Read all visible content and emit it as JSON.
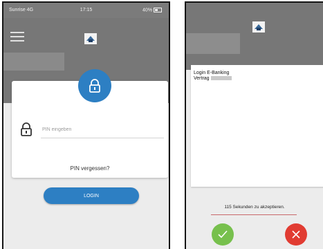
{
  "status_bar": {
    "carrier": "Sunrise  4G",
    "time": "17:15",
    "battery": "40%"
  },
  "login_screen": {
    "pin_placeholder": "PIN eingeben",
    "forgot_pin": "PIN vergessen?",
    "login_button": "LOGIN"
  },
  "confirm_screen": {
    "title": "Login E-Banking",
    "contract_label": "Vertrag",
    "countdown": "115 Sekunden zu akzeptieren."
  },
  "icons": [
    "menu-icon",
    "logo-icon",
    "lock-icon",
    "check-icon",
    "x-icon"
  ],
  "colors": {
    "primary_blue": "#2d7fc3",
    "accept_green": "#77c04d",
    "decline_red": "#e13c32",
    "header_gray": "#777777"
  }
}
